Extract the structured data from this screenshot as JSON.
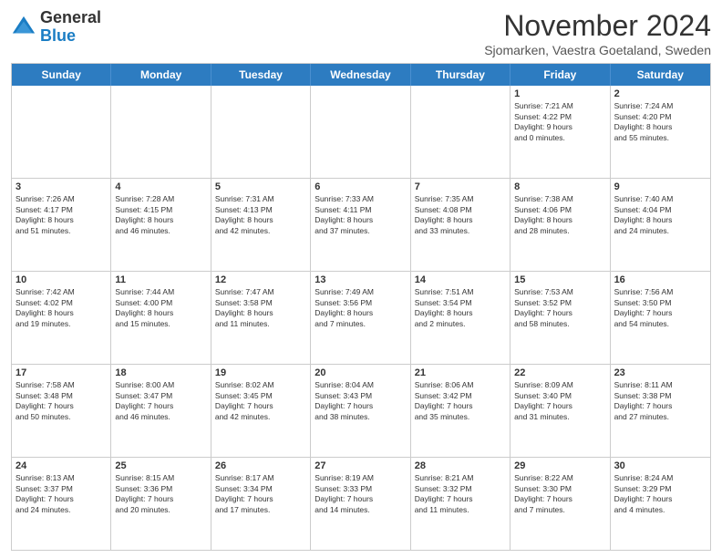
{
  "logo": {
    "general": "General",
    "blue": "Blue"
  },
  "title": "November 2024",
  "subtitle": "Sjomarken, Vaestra Goetaland, Sweden",
  "header_days": [
    "Sunday",
    "Monday",
    "Tuesday",
    "Wednesday",
    "Thursday",
    "Friday",
    "Saturday"
  ],
  "weeks": [
    [
      {
        "day": "",
        "info": ""
      },
      {
        "day": "",
        "info": ""
      },
      {
        "day": "",
        "info": ""
      },
      {
        "day": "",
        "info": ""
      },
      {
        "day": "",
        "info": ""
      },
      {
        "day": "1",
        "info": "Sunrise: 7:21 AM\nSunset: 4:22 PM\nDaylight: 9 hours\nand 0 minutes."
      },
      {
        "day": "2",
        "info": "Sunrise: 7:24 AM\nSunset: 4:20 PM\nDaylight: 8 hours\nand 55 minutes."
      }
    ],
    [
      {
        "day": "3",
        "info": "Sunrise: 7:26 AM\nSunset: 4:17 PM\nDaylight: 8 hours\nand 51 minutes."
      },
      {
        "day": "4",
        "info": "Sunrise: 7:28 AM\nSunset: 4:15 PM\nDaylight: 8 hours\nand 46 minutes."
      },
      {
        "day": "5",
        "info": "Sunrise: 7:31 AM\nSunset: 4:13 PM\nDaylight: 8 hours\nand 42 minutes."
      },
      {
        "day": "6",
        "info": "Sunrise: 7:33 AM\nSunset: 4:11 PM\nDaylight: 8 hours\nand 37 minutes."
      },
      {
        "day": "7",
        "info": "Sunrise: 7:35 AM\nSunset: 4:08 PM\nDaylight: 8 hours\nand 33 minutes."
      },
      {
        "day": "8",
        "info": "Sunrise: 7:38 AM\nSunset: 4:06 PM\nDaylight: 8 hours\nand 28 minutes."
      },
      {
        "day": "9",
        "info": "Sunrise: 7:40 AM\nSunset: 4:04 PM\nDaylight: 8 hours\nand 24 minutes."
      }
    ],
    [
      {
        "day": "10",
        "info": "Sunrise: 7:42 AM\nSunset: 4:02 PM\nDaylight: 8 hours\nand 19 minutes."
      },
      {
        "day": "11",
        "info": "Sunrise: 7:44 AM\nSunset: 4:00 PM\nDaylight: 8 hours\nand 15 minutes."
      },
      {
        "day": "12",
        "info": "Sunrise: 7:47 AM\nSunset: 3:58 PM\nDaylight: 8 hours\nand 11 minutes."
      },
      {
        "day": "13",
        "info": "Sunrise: 7:49 AM\nSunset: 3:56 PM\nDaylight: 8 hours\nand 7 minutes."
      },
      {
        "day": "14",
        "info": "Sunrise: 7:51 AM\nSunset: 3:54 PM\nDaylight: 8 hours\nand 2 minutes."
      },
      {
        "day": "15",
        "info": "Sunrise: 7:53 AM\nSunset: 3:52 PM\nDaylight: 7 hours\nand 58 minutes."
      },
      {
        "day": "16",
        "info": "Sunrise: 7:56 AM\nSunset: 3:50 PM\nDaylight: 7 hours\nand 54 minutes."
      }
    ],
    [
      {
        "day": "17",
        "info": "Sunrise: 7:58 AM\nSunset: 3:48 PM\nDaylight: 7 hours\nand 50 minutes."
      },
      {
        "day": "18",
        "info": "Sunrise: 8:00 AM\nSunset: 3:47 PM\nDaylight: 7 hours\nand 46 minutes."
      },
      {
        "day": "19",
        "info": "Sunrise: 8:02 AM\nSunset: 3:45 PM\nDaylight: 7 hours\nand 42 minutes."
      },
      {
        "day": "20",
        "info": "Sunrise: 8:04 AM\nSunset: 3:43 PM\nDaylight: 7 hours\nand 38 minutes."
      },
      {
        "day": "21",
        "info": "Sunrise: 8:06 AM\nSunset: 3:42 PM\nDaylight: 7 hours\nand 35 minutes."
      },
      {
        "day": "22",
        "info": "Sunrise: 8:09 AM\nSunset: 3:40 PM\nDaylight: 7 hours\nand 31 minutes."
      },
      {
        "day": "23",
        "info": "Sunrise: 8:11 AM\nSunset: 3:38 PM\nDaylight: 7 hours\nand 27 minutes."
      }
    ],
    [
      {
        "day": "24",
        "info": "Sunrise: 8:13 AM\nSunset: 3:37 PM\nDaylight: 7 hours\nand 24 minutes."
      },
      {
        "day": "25",
        "info": "Sunrise: 8:15 AM\nSunset: 3:36 PM\nDaylight: 7 hours\nand 20 minutes."
      },
      {
        "day": "26",
        "info": "Sunrise: 8:17 AM\nSunset: 3:34 PM\nDaylight: 7 hours\nand 17 minutes."
      },
      {
        "day": "27",
        "info": "Sunrise: 8:19 AM\nSunset: 3:33 PM\nDaylight: 7 hours\nand 14 minutes."
      },
      {
        "day": "28",
        "info": "Sunrise: 8:21 AM\nSunset: 3:32 PM\nDaylight: 7 hours\nand 11 minutes."
      },
      {
        "day": "29",
        "info": "Sunrise: 8:22 AM\nSunset: 3:30 PM\nDaylight: 7 hours\nand 7 minutes."
      },
      {
        "day": "30",
        "info": "Sunrise: 8:24 AM\nSunset: 3:29 PM\nDaylight: 7 hours\nand 4 minutes."
      }
    ]
  ]
}
